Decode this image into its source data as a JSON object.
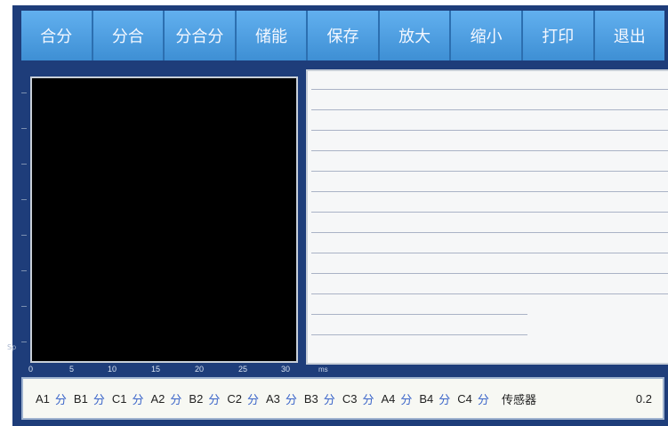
{
  "toolbar": {
    "buttons": [
      "合分",
      "分合",
      "分合分",
      "储能",
      "保存",
      "放大",
      "缩小",
      "打印",
      "退出"
    ]
  },
  "plot": {
    "y_label": "Sp",
    "x_ticks": [
      "0",
      "5",
      "10",
      "15",
      "20",
      "25",
      "30"
    ],
    "x_unit": "ms"
  },
  "status": {
    "channels": [
      {
        "label": "A1",
        "state": "分"
      },
      {
        "label": "B1",
        "state": "分"
      },
      {
        "label": "C1",
        "state": "分"
      },
      {
        "label": "A2",
        "state": "分"
      },
      {
        "label": "B2",
        "state": "分"
      },
      {
        "label": "C2",
        "state": "分"
      },
      {
        "label": "A3",
        "state": "分"
      },
      {
        "label": "B3",
        "state": "分"
      },
      {
        "label": "C3",
        "state": "分"
      },
      {
        "label": "A4",
        "state": "分"
      },
      {
        "label": "B4",
        "state": "分"
      },
      {
        "label": "C4",
        "state": "分"
      }
    ],
    "sensor_label": "传感器",
    "sensor_value": "0.2"
  },
  "colors": {
    "toolbar": "#4a9ee0",
    "frame": "#1e3d7a",
    "state_text": "#3a64c9"
  }
}
